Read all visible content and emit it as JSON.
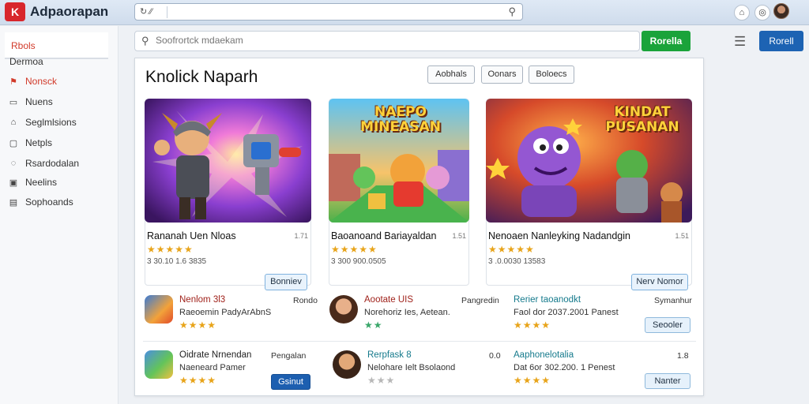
{
  "app": {
    "logo_glyph": "K",
    "title": "Adpaorapan"
  },
  "browser": {
    "url_controls": "↻ ⁄⁄",
    "url_value": ""
  },
  "sidebar": {
    "tab": "Rbols",
    "subtitle": "Dermoa",
    "items": [
      {
        "icon": "flame-icon",
        "glyph": "⚑",
        "label": "Nonsck",
        "active": true
      },
      {
        "icon": "screen-icon",
        "glyph": "▭",
        "label": "Nuens",
        "active": false
      },
      {
        "icon": "house-icon",
        "glyph": "⌂",
        "label": "Seglmlsions",
        "active": false
      },
      {
        "icon": "doc-icon",
        "glyph": "▢",
        "label": "Netpls",
        "active": false
      },
      {
        "icon": "drop-icon",
        "glyph": "◌",
        "label": "Rsardodalan",
        "active": false
      },
      {
        "icon": "grid-icon",
        "glyph": "▣",
        "label": "Neelins",
        "active": false
      },
      {
        "icon": "list-icon",
        "glyph": "▤",
        "label": "Sophoands",
        "active": false
      }
    ]
  },
  "search": {
    "placeholder": "Soofrortck mdaekam",
    "value": ""
  },
  "header_actions": {
    "green_button": "Rorella",
    "blue_button": "Rorell"
  },
  "panel": {
    "title": "Knolick Naparh",
    "chips": [
      "Aobhals",
      "Oonars",
      "Boloecs"
    ]
  },
  "featured": [
    {
      "name": "Rananah Uen Nloas",
      "size": "1.71",
      "stars": "★★★★★",
      "meta": "3 30.10 1.6 3835",
      "button": "Bonniev",
      "art_title": ""
    },
    {
      "name": "Baoanoand Bariayaldan",
      "size": "1.51",
      "stars": "★★★★★",
      "meta": "3 300 900.0505",
      "button": "",
      "art_title": "NAEPO MINEASAN"
    },
    {
      "name": "Nenoaen Nanleyking Nadandgin",
      "size": "1.51",
      "stars": "★★★★★",
      "meta": "3 .0.0030 13583",
      "button": "Nerv Nomor",
      "art_title": "KINDAT PUSANAN"
    }
  ],
  "list": [
    {
      "title": "Nenlom 3l3",
      "title_color": "#a0231c",
      "sub": "Raeoemin PadyArAbnS",
      "stars": "★★★★",
      "right": "Rondo",
      "button": ""
    },
    {
      "title": "Aootate UIS",
      "title_color": "#a0231c",
      "sub": "Norehoriz Ies, Aetean.",
      "stars": "★★",
      "right": "Pangredin",
      "button": ""
    },
    {
      "title": "Rerier taoanodkt",
      "title_color": "#157a8c",
      "sub": "Faol dor 2037.2001 Panest",
      "stars": "★★★★",
      "right": "Symanhur",
      "button": "Seooler"
    },
    {
      "title": "Oidrate Nrnendan",
      "title_color": "#222",
      "sub": "Naeneard Pamer",
      "stars": "★★★★",
      "right": "Pengalan",
      "button": "Gsinut"
    },
    {
      "title": "Rerpfask 8",
      "title_color": "#157a8c",
      "sub": "Nelohare Ielt Bsolaond",
      "stars": "★★★",
      "right": "0.0",
      "button": ""
    },
    {
      "title": "Aaphonelotalia",
      "title_color": "#157a8c",
      "sub": "Dat 6or 302.200. 1 Penest",
      "stars": "★★★★",
      "right": "1.8",
      "button": "Nanter"
    }
  ]
}
